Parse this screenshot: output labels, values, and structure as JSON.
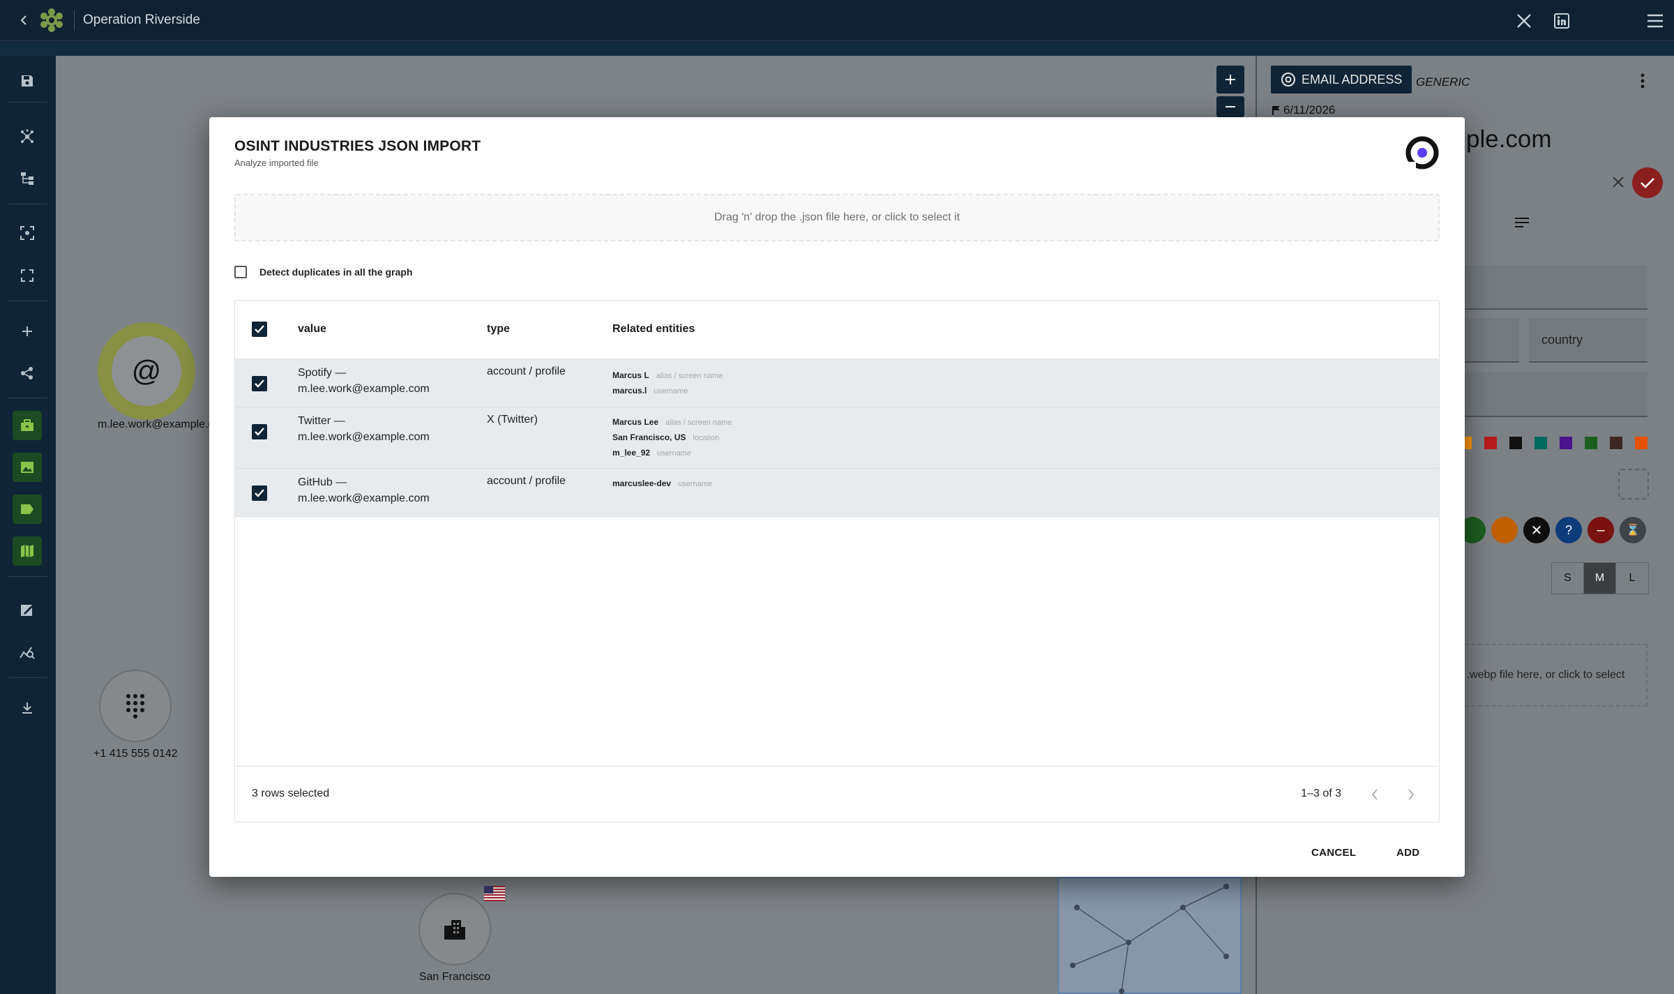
{
  "app": {
    "title": "Operation Riverside"
  },
  "topbar": {
    "icons": [
      "back-icon",
      "app-logo",
      "x-icon",
      "linkedin-icon",
      "menu-icon"
    ]
  },
  "sidebar": {
    "icons": [
      "save-icon",
      "graph-icon",
      "hierarchy-icon",
      "focus-icon",
      "fullscreen-icon",
      "add-icon",
      "share-icon",
      "toolbox-icon",
      "image-icon",
      "tag-icon",
      "map-icon",
      "edit-icon",
      "analytics-icon",
      "download-icon"
    ]
  },
  "canvas": {
    "nodes": [
      {
        "label": "m.lee.work@example.com",
        "icon": "at-icon"
      },
      {
        "label": "+1 415 555 0142",
        "icon": "dialpad-icon"
      },
      {
        "label": "San Francisco",
        "icon": "city-icon"
      }
    ]
  },
  "right_panel": {
    "type_chip": "EMAIL ADDRESS",
    "generic": "GENERIC",
    "date": "6/11/2026",
    "title_fragment": "ple.com",
    "country_select": "country",
    "sizes": [
      "S",
      "M",
      "L"
    ],
    "dropzone_fragment": ".webp file here, or click to select",
    "colors": [
      "#ff9800",
      "#b71c1c",
      "#111111",
      "#00695c",
      "#4a148c",
      "#1b5e20",
      "#3e2723",
      "#e65100"
    ]
  },
  "dialog": {
    "title": "OSINT INDUSTRIES JSON IMPORT",
    "subtitle": "Analyze imported file",
    "dropzone": "Drag 'n' drop the .json file here, or click to select it",
    "duplicates_label": "Detect duplicates in all the graph",
    "columns": {
      "value": "value",
      "type": "type",
      "related": "Related entities"
    },
    "rows": [
      {
        "value_line1": "Spotify —",
        "value_line2": "m.lee.work@example.com",
        "type": "account / profile",
        "related": [
          {
            "value": "Marcus L",
            "type": "alias / screen name"
          },
          {
            "value": "marcus.l",
            "type": "username"
          }
        ]
      },
      {
        "value_line1": "Twitter —",
        "value_line2": "m.lee.work@example.com",
        "type": "X (Twitter)",
        "related": [
          {
            "value": "Marcus Lee",
            "type": "alias / screen name"
          },
          {
            "value": "San Francisco, US",
            "type": "location"
          },
          {
            "value": "m_lee_92",
            "type": "username"
          }
        ]
      },
      {
        "value_line1": "GitHub —",
        "value_line2": "m.lee.work@example.com",
        "type": "account / profile",
        "related": [
          {
            "value": "marcuslee-dev",
            "type": "username"
          }
        ]
      }
    ],
    "footer": {
      "selected": "3 rows selected",
      "pagination": "1–3 of 3"
    },
    "buttons": {
      "cancel": "CANCEL",
      "add": "ADD"
    }
  }
}
